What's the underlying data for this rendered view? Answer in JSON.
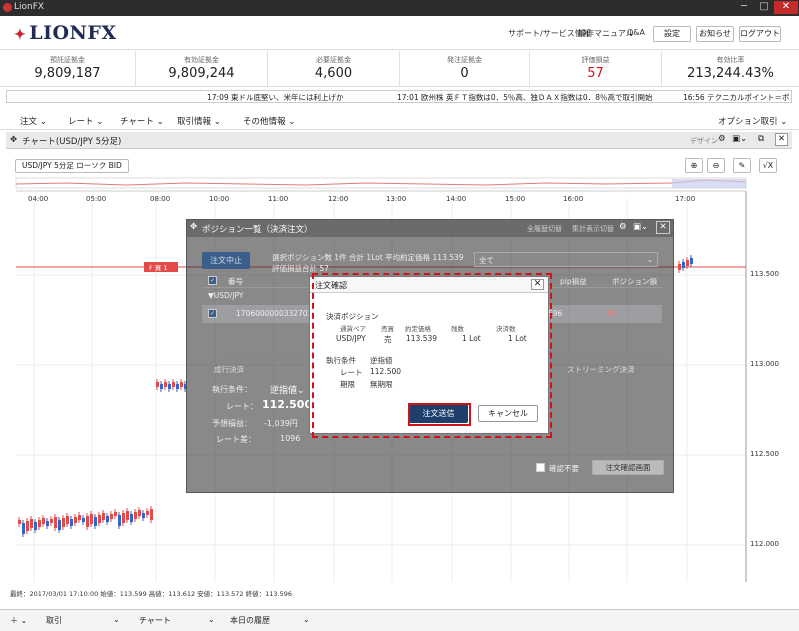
{
  "window": {
    "title": "LionFX"
  },
  "header": {
    "logo": "LIONFX",
    "links": [
      "サポート/サービス情報",
      "操作マニュアル",
      "Q&A"
    ],
    "buttons": [
      "設定",
      "お知らせ",
      "ログアウト"
    ]
  },
  "summary": [
    {
      "label": "預託証拠金",
      "value": "9,809,187"
    },
    {
      "label": "有効証拠金",
      "value": "9,809,244"
    },
    {
      "label": "必要証拠金",
      "value": "4,600"
    },
    {
      "label": "発注証拠金",
      "value": "0"
    },
    {
      "label": "評価損益",
      "value": "57"
    },
    {
      "label": "有効比率",
      "value": "213,244.43%"
    }
  ],
  "ticker": [
    "17:09 東ドル底堅い、米年には利上げか",
    "17:01 欧州株 英ＦＴ指数は0．5％高、独ＤＡＸ指数は0．8％高で取引開始",
    "16:56 テクニカルポイント＝ポンド円サポ"
  ],
  "menu": [
    "注文",
    "レート",
    "チャート",
    "取引情報",
    "その他情報"
  ],
  "menu_right": "オプション取引",
  "chart_panel": {
    "title": "チャート(USD/JPY 5分足)",
    "design": "デザイン",
    "symbol_button": "USD/JPY 5分足 ローソク BID"
  },
  "chart_data": {
    "type": "candlestick",
    "x_ticks": [
      "04:00",
      "05:00",
      "08:00",
      "10:00",
      "11:00",
      "12:00",
      "13:00",
      "14:00",
      "15:00",
      "16:00",
      "17:00"
    ],
    "y_ticks": [
      "113.500",
      "113.000",
      "112.500",
      "112.000"
    ],
    "order_marker": "F 買 1",
    "info": "最終：2017/03/01 17:10:00 始値：113.599 高値：113.612 安値：113.572 終値：113.596"
  },
  "position_window": {
    "title": "ポジション一覧（決済注文）",
    "top_links": [
      "全履歴切替",
      "集計表示切替"
    ],
    "stop_button": "注文中止",
    "selection_summary": "選択ポジション数 1件  合計 1Lot 平均約定価格 113.539",
    "pnl_summary": "評価損益合計  57",
    "filter": "全て",
    "col_no": "番号",
    "col_pip": "pip損益",
    "col_pos": "ポジション損",
    "group": "▼USD/JPY",
    "row_id": "1706000000332703",
    "row_pip": "596",
    "row_pos": "57",
    "tab_left": "成行決済",
    "tab_right": "ストリーミング決済",
    "cond_label": "執行条件：",
    "cond_value": "逆指値",
    "rate_label": "レート：",
    "rate_value": "112.500",
    "pred_label": "予想損益：",
    "pred_value": "-1,039円",
    "diff_label": "レート差：",
    "diff_value": "1096",
    "no_confirm": "確認不要",
    "confirm_screen": "注文確認画面"
  },
  "dialog": {
    "title": "注文確認",
    "section": "決済ポジション",
    "headers": [
      "通貨ペア",
      "売買",
      "約定価格",
      "残数",
      "決済数"
    ],
    "values": [
      "USD/JPY",
      "売",
      "113.539",
      "1 Lot",
      "1 Lot"
    ],
    "exec_label": "執行条件",
    "exec_value": "逆指値",
    "rate_label": "レート",
    "rate_value": "112.500",
    "period_label": "期限",
    "period_value": "無期限",
    "send": "注文送信",
    "cancel": "キャンセル"
  },
  "bottom_tabs": [
    "取引",
    "チャート",
    "本日の履歴"
  ]
}
